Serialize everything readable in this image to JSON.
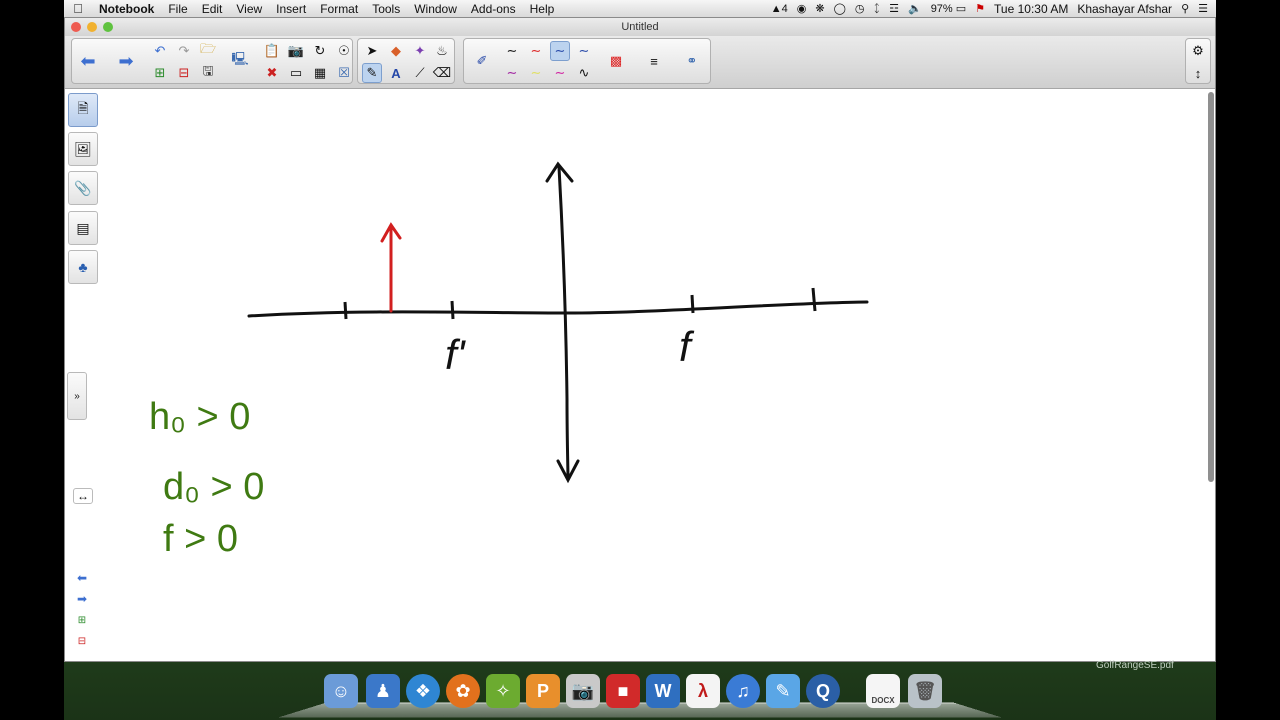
{
  "menubar": {
    "app": "Notebook",
    "menus": [
      "File",
      "Edit",
      "View",
      "Insert",
      "Format",
      "Tools",
      "Window",
      "Add-ons",
      "Help"
    ],
    "status": {
      "adobe": "4",
      "battery": "97%",
      "clock": "Tue 10:30 AM",
      "user": "Khashayar Afshar"
    }
  },
  "window": {
    "title": "Untitled"
  },
  "whiteboard": {
    "axis_labels": {
      "left_focal": "f'",
      "right_focal": "f"
    },
    "conditions": [
      "h₀ > 0",
      "d₀ > 0",
      "f > 0"
    ],
    "colors": {
      "ink_black": "#111111",
      "ink_red": "#d21f1f",
      "ink_green": "#3f7a12"
    }
  },
  "dock": {
    "icons": [
      "finder",
      "contacts",
      "safari",
      "firefox",
      "app",
      "app",
      "preview",
      "sketchup",
      "word",
      "acrobat",
      "itunes",
      "textedit",
      "quicktime",
      "document",
      "trash"
    ],
    "document_label": "DOCX"
  },
  "desktop": {
    "file_label": "GolfRangeSE.pdf"
  }
}
